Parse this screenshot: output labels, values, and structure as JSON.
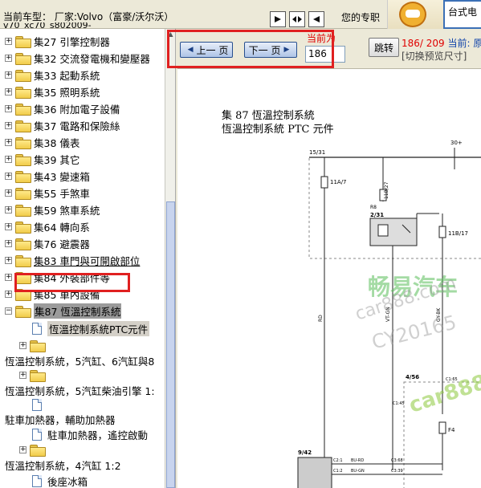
{
  "header": {
    "model_label": "当前车型：  厂家:Volvo（富豪/沃尔沃）",
    "model_sub": "v70_xc70_s802009-",
    "promo_text": "您的专职",
    "promo_right": "台式电"
  },
  "tree": {
    "items": [
      {
        "label": "集27 引擎控制器"
      },
      {
        "label": "集32 交流發電機和變壓器"
      },
      {
        "label": "集33 起動系統"
      },
      {
        "label": "集35 照明系統"
      },
      {
        "label": "集36 附加電子設備"
      },
      {
        "label": "集37 電路和保險絲"
      },
      {
        "label": "集38 儀表"
      },
      {
        "label": "集39 其它"
      },
      {
        "label": "集43 變速箱"
      },
      {
        "label": "集55 手煞車"
      },
      {
        "label": "集59 煞車系統"
      },
      {
        "label": "集64 轉向系"
      },
      {
        "label": "集76 避震器"
      },
      {
        "label": "集83 車門與可開啟部位"
      },
      {
        "label": "集84 外裝部件等"
      },
      {
        "label": "集85 車內設備"
      },
      {
        "label": "集87 恆溫控制系統"
      }
    ],
    "sub_items": [
      {
        "label": "恆溫控制系統PTC元件"
      },
      {
        "label": "恆溫控制系統，5汽缸、6汽缸與8"
      },
      {
        "label": "恆溫控制系統，5汽缸柴油引擎 1:"
      },
      {
        "label": "駐車加熱器，輔助加熱器"
      },
      {
        "label": "駐車加熱器，遙控啟動"
      },
      {
        "label": "恆溫控制系統，4汽缸 1:2"
      },
      {
        "label": "後座冰箱"
      }
    ]
  },
  "toolbar": {
    "prev_label": "上一 页",
    "next_label": "下一 页",
    "current_label": "当前为",
    "page_value": "186",
    "jump_label": "跳转",
    "page_count": "186/ 209",
    "current_original": "当前: 原չ",
    "switch_size": "[切换预览尺寸]"
  },
  "document": {
    "title1": "集 87 恆溫控制系統",
    "title2": "恆溫控制系統 PTC 元件",
    "labels": {
      "bus_left": "15/31",
      "bus_right": "30+",
      "fuse1": "11A/7",
      "fuse2": "11B/27",
      "relay_ref": "R8",
      "relay_id": "2/31",
      "fuse3": "11B/17",
      "wire_rd": "RD",
      "wire_vt": "VT-GN",
      "wire_gy": "GY-BK",
      "box_id": "4/56",
      "c165": "C1:65",
      "c145": "C1:45",
      "f4": "F4",
      "ptc_id": "9/42",
      "c21": "C2:1",
      "c12": "C1:2",
      "c368": "C3:68",
      "c339": "C3:39",
      "bu_rd": "BU-RD",
      "bu_gn": "BU-GN"
    },
    "watermarks": [
      "畅易汽车",
      "car888.com",
      "CY20165",
      "car888"
    ]
  }
}
